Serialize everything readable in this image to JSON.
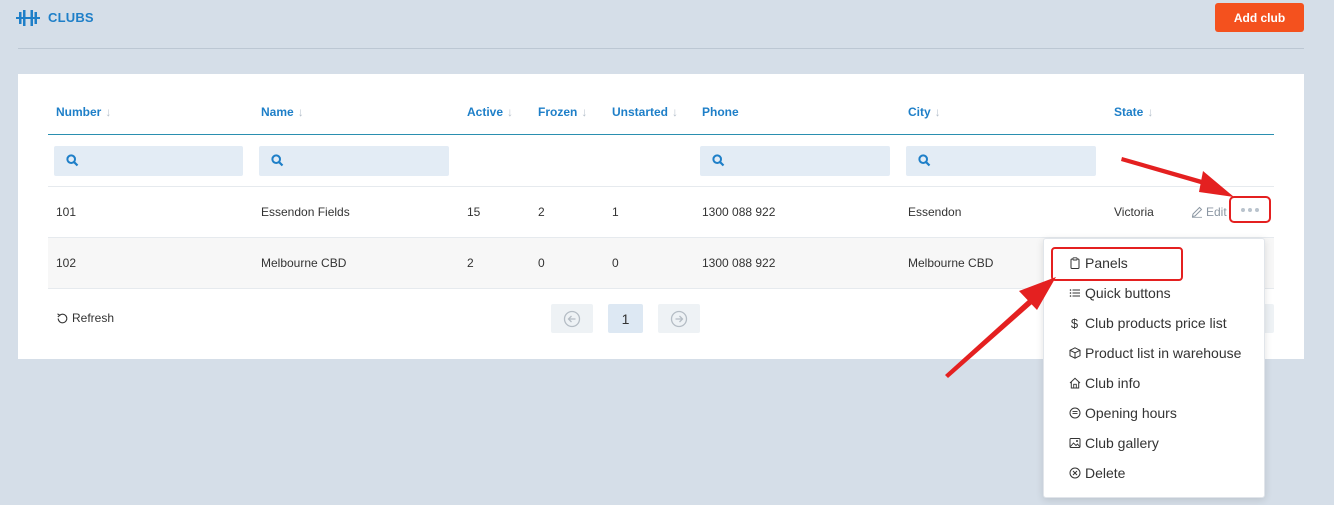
{
  "header": {
    "title": "CLUBS",
    "add_button": "Add club"
  },
  "table": {
    "columns": [
      "Number",
      "Name",
      "Active",
      "Frozen",
      "Unstarted",
      "Phone",
      "City",
      "State"
    ],
    "rows": [
      [
        "101",
        "Essendon Fields",
        "15",
        "2",
        "1",
        "1300 088 922",
        "Essendon",
        "Victoria"
      ],
      [
        "102",
        "Melbourne CBD",
        "2",
        "0",
        "0",
        "1300 088 922",
        "Melbourne CBD",
        ""
      ]
    ],
    "row_actions": {
      "edit_label": "Edit"
    }
  },
  "footer": {
    "refresh_label": "Refresh",
    "current_page": "1"
  },
  "menu": {
    "items": [
      {
        "label": "Panels",
        "icon": "clipboard-icon"
      },
      {
        "label": "Quick buttons",
        "icon": "list-icon"
      },
      {
        "label": "Club products price list",
        "icon": "dollar-icon"
      },
      {
        "label": "Product list in warehouse",
        "icon": "box-icon"
      },
      {
        "label": "Club info",
        "icon": "home-icon"
      },
      {
        "label": "Opening hours",
        "icon": "clock-icon"
      },
      {
        "label": "Club gallery",
        "icon": "image-icon"
      },
      {
        "label": "Delete",
        "icon": "close-circle-icon"
      }
    ]
  },
  "colors": {
    "accent": "#1e7fc8",
    "primary_button": "#f4511e",
    "annotation": "#e42020"
  }
}
